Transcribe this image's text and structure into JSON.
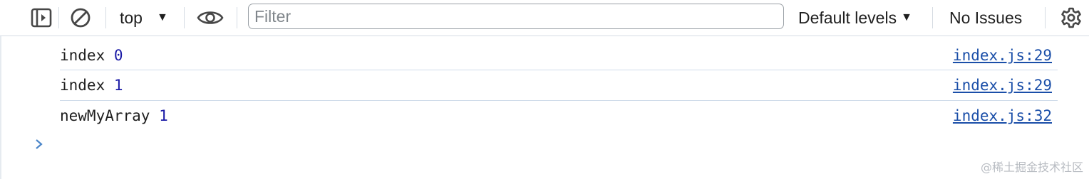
{
  "toolbar": {
    "context": "top",
    "filter_placeholder": "Filter",
    "levels": "Default levels",
    "issues": "No Issues"
  },
  "icons": {
    "sidebar": "sidebar-toggle-icon",
    "clear": "clear-console-icon",
    "context_caret": "caret-down-icon",
    "live_expression": "eye-icon",
    "levels_caret": "caret-down-icon",
    "settings": "gear-icon",
    "prompt": "chevron-right-icon"
  },
  "messages": [
    {
      "label": "index",
      "value": "0",
      "source": "index.js:29"
    },
    {
      "label": "index",
      "value": "1",
      "source": "index.js:29"
    },
    {
      "label": "newMyArray",
      "value": "1",
      "source": "index.js:32"
    }
  ],
  "watermark": "@稀土掘金技术社区",
  "colors": {
    "number": "#1a1aa6",
    "link": "#1a4ea8",
    "prompt": "#4b86c9",
    "separator": "#cfdcea"
  }
}
